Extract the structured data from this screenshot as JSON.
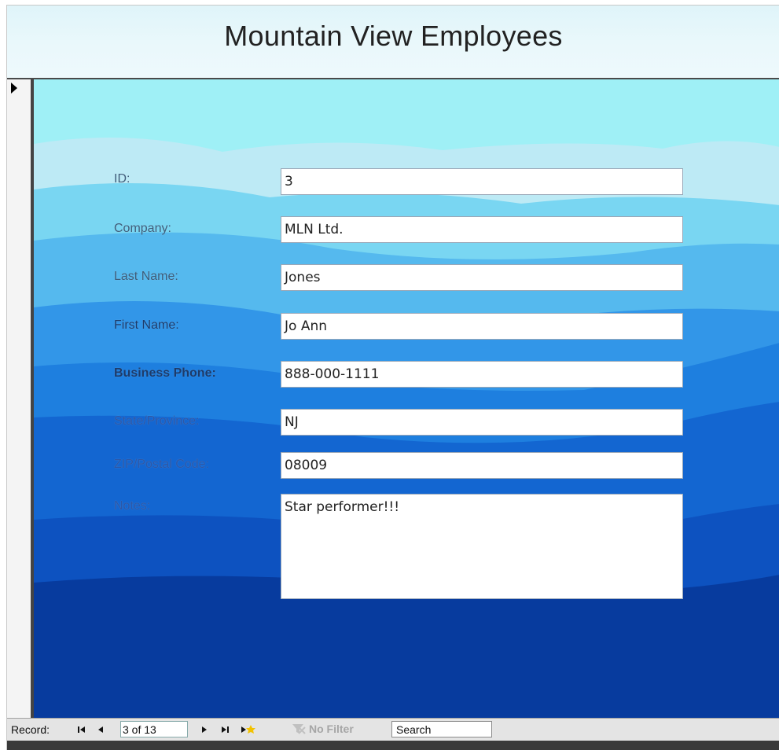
{
  "form": {
    "title": "Mountain View Employees"
  },
  "fields": [
    {
      "label": "ID:",
      "value": "3"
    },
    {
      "label": "Company:",
      "value": "MLN Ltd."
    },
    {
      "label": "Last Name:",
      "value": "Jones"
    },
    {
      "label": "First Name:",
      "value": "Jo Ann"
    },
    {
      "label": "Business Phone:",
      "value": "888-000-1111"
    },
    {
      "label": "State/Province:",
      "value": "NJ"
    },
    {
      "label": "ZIP/Postal Code:",
      "value": "08009"
    },
    {
      "label": "Notes:",
      "value": "Star performer!!!"
    }
  ],
  "navigation": {
    "record_label": "Record:",
    "current_record": "3 of 13",
    "filter_label": "No Filter",
    "search_label": "Search"
  },
  "icons": {
    "record_selector": "record-selector-arrow-icon",
    "first": "first-record-icon",
    "previous": "previous-record-icon",
    "next": "next-record-icon",
    "last": "last-record-icon",
    "new": "new-record-icon",
    "filter": "filter-icon"
  },
  "colors": {
    "sky": "#9ff0f6",
    "mountain_far": "#61c8f0",
    "mountain_mid": "#1e86e4",
    "mountain_dark": "#0d4fbc",
    "mountain_deepest": "#073597"
  }
}
